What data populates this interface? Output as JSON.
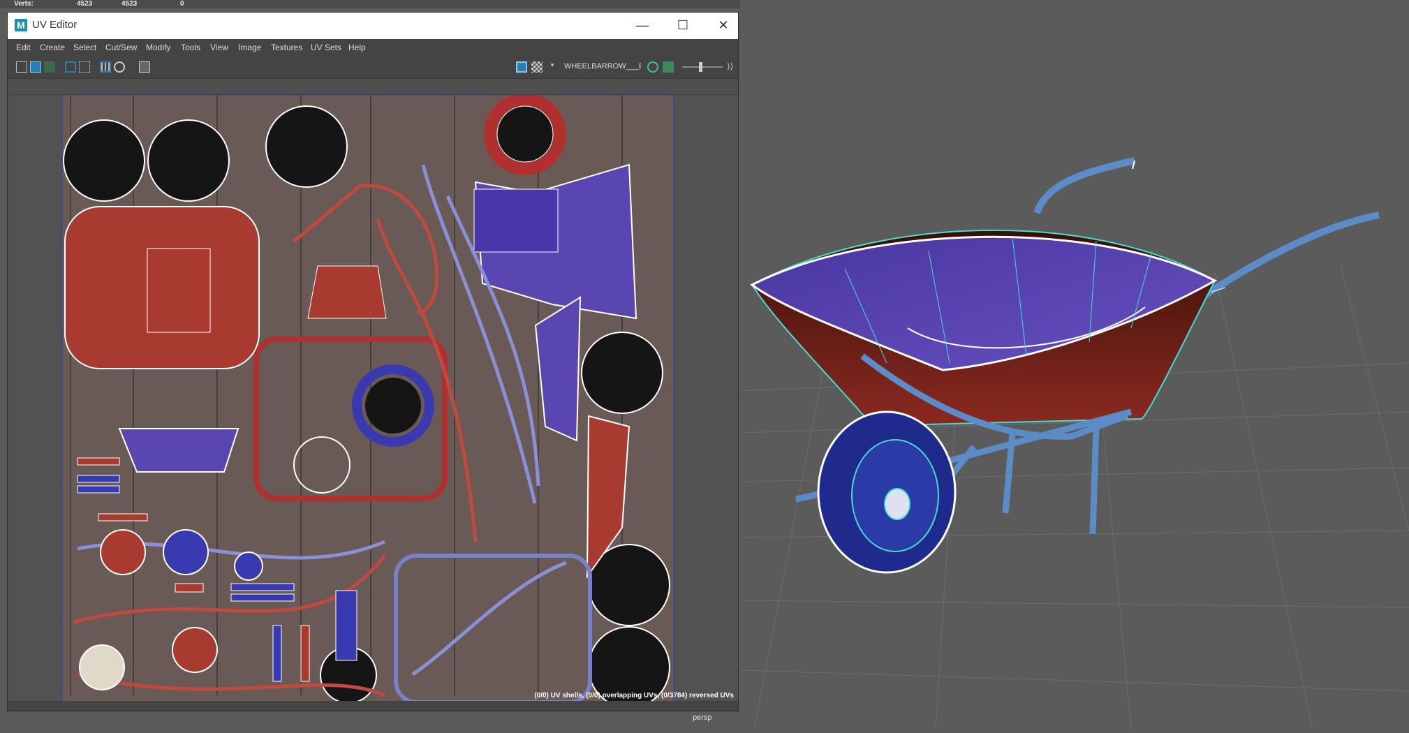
{
  "hud": {
    "label": "Verts:",
    "value1": "4523",
    "value2": "4523",
    "value3": "0"
  },
  "window": {
    "title": "UV Editor",
    "logo": "M",
    "minimize_icon": "minimize-icon",
    "maximize_icon": "maximize-icon",
    "close_icon": "close-icon"
  },
  "menu": [
    "Edit",
    "Create",
    "Select",
    "Cut/Sew",
    "Modify",
    "Tools",
    "View",
    "Image",
    "Textures",
    "UV Sets",
    "Help"
  ],
  "toolbar": {
    "texture_name": "WHEELBARROW___Ba:",
    "slider_value": 0.45
  },
  "uv_status": "(0/0) UV shells, (0/0) overlapping UVs, (0/3784) reversed UVs",
  "viewport": {
    "camera": "persp"
  },
  "colors": {
    "accent": "#1e90c8",
    "red_paint": "#a83a30",
    "blue_paint": "#5a46b0",
    "wire_cyan": "#40e0d0"
  }
}
